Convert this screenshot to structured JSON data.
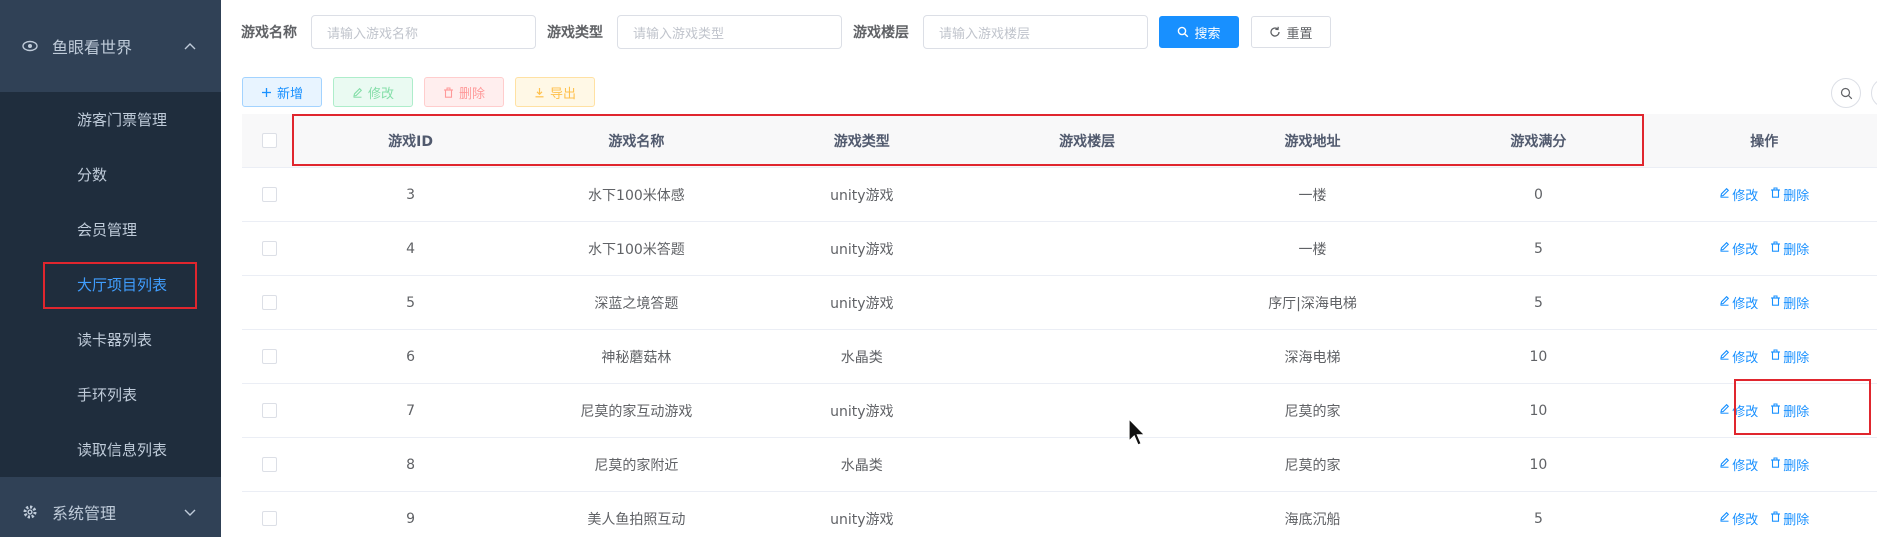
{
  "sidebar": {
    "group_title": "鱼眼看世界",
    "items": [
      {
        "label": "游客门票管理"
      },
      {
        "label": "分数"
      },
      {
        "label": "会员管理"
      },
      {
        "label": "大厅项目列表"
      },
      {
        "label": "读卡器列表"
      },
      {
        "label": "手环列表"
      },
      {
        "label": "读取信息列表"
      }
    ],
    "system_title": "系统管理"
  },
  "search": {
    "name_label": "游戏名称",
    "name_placeholder": "请输入游戏名称",
    "type_label": "游戏类型",
    "type_placeholder": "请输入游戏类型",
    "floor_label": "游戏楼层",
    "floor_placeholder": "请输入游戏楼层",
    "search_btn": "搜索",
    "reset_btn": "重置"
  },
  "toolbar": {
    "add": "新增",
    "edit": "修改",
    "delete": "删除",
    "export": "导出"
  },
  "table": {
    "headers": [
      "游戏ID",
      "游戏名称",
      "游戏类型",
      "游戏楼层",
      "游戏地址",
      "游戏满分",
      "操作"
    ],
    "op_edit": "修改",
    "op_delete": "删除",
    "rows": [
      {
        "id": "3",
        "name": "水下100米体感",
        "type": "unity游戏",
        "floor": "",
        "addr": "一楼",
        "score": "0"
      },
      {
        "id": "4",
        "name": "水下100米答题",
        "type": "unity游戏",
        "floor": "",
        "addr": "一楼",
        "score": "5"
      },
      {
        "id": "5",
        "name": "深蓝之境答题",
        "type": "unity游戏",
        "floor": "",
        "addr": "序厅|深海电梯",
        "score": "5"
      },
      {
        "id": "6",
        "name": "神秘蘑菇林",
        "type": "水晶类",
        "floor": "",
        "addr": "深海电梯",
        "score": "10"
      },
      {
        "id": "7",
        "name": "尼莫的家互动游戏",
        "type": "unity游戏",
        "floor": "",
        "addr": "尼莫的家",
        "score": "10"
      },
      {
        "id": "8",
        "name": "尼莫的家附近",
        "type": "水晶类",
        "floor": "",
        "addr": "尼莫的家",
        "score": "10"
      },
      {
        "id": "9",
        "name": "美人鱼拍照互动",
        "type": "unity游戏",
        "floor": "",
        "addr": "海底沉船",
        "score": "5"
      }
    ]
  },
  "colors": {
    "sidebar_bg": "#304156",
    "submenu_bg": "#1f2d3d",
    "active": "#409eff",
    "primary": "#1890ff",
    "highlight": "#e0262e"
  }
}
